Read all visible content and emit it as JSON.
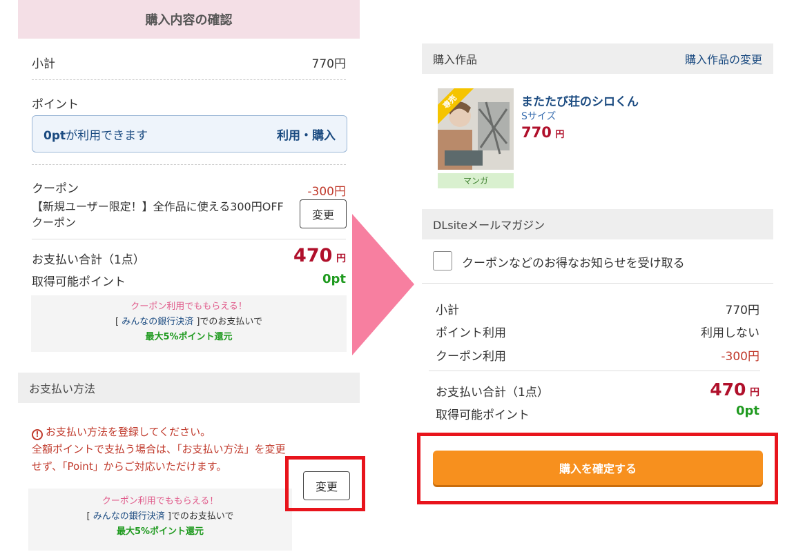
{
  "left": {
    "header_title": "購入内容の確認",
    "subtotal_label": "小計",
    "subtotal_value": "770円",
    "point_title": "ポイント",
    "point_available_amount": "0pt",
    "point_available_text": "が利用できます",
    "point_action": "利用・購入",
    "coupon_title": "クーポン",
    "coupon_amount": "-300円",
    "coupon_desc": "【新規ユーザー限定！】全作品に使える300円OFFクーポン",
    "change_label": "変更",
    "total_label": "お支払い合計（1点）",
    "total_value": "470",
    "total_unit": "円",
    "earn_label": "取得可能ポイント",
    "earn_value": "0pt",
    "promo": {
      "line1": "クーポン利用でももらえる！",
      "bracket_open": "[ ",
      "bank": "みんなの銀行決済",
      "line2_rest": " ]でのお支払いで",
      "line3": "最大5%ポイント還元"
    },
    "payment_header": "お支払い方法",
    "payment_warning_line1": "お支払い方法を登録してください。",
    "payment_warning_line2": "全額ポイントで支払う場合は、「お支払い方法」を変更せず、「Point」からご対応いただけます。",
    "payment_change_label": "変更"
  },
  "right": {
    "work_header": "購入作品",
    "work_change_link": "購入作品の変更",
    "ribbon": "専売",
    "manga_tag": "マンガ",
    "work_title": "またたび荘のシロくん",
    "work_size": "Sサイズ",
    "work_price": "770",
    "work_price_unit": "円",
    "mail_header": "DLsiteメールマガジン",
    "mail_checkbox_label": "クーポンなどのお得なお知らせを受け取る",
    "mail_checked": false,
    "rows": [
      {
        "label": "小計",
        "value": "770円"
      },
      {
        "label": "ポイント利用",
        "value": "利用しない"
      },
      {
        "label": "クーポン利用",
        "value": "-300円"
      }
    ],
    "total_label": "お支払い合計（1点）",
    "total_value": "470",
    "total_unit": "円",
    "earn_label": "取得可能ポイント",
    "earn_value": "0pt",
    "confirm_button": "購入を確定する"
  },
  "colors": {
    "accent_pink": "#f4dfe6",
    "price_red": "#b0102b",
    "point_green": "#1f9a1f",
    "link_blue": "#1a4a80",
    "confirm_orange": "#f7901e",
    "highlight_red": "#e8141c",
    "arrow_pink": "#f77fa0"
  }
}
